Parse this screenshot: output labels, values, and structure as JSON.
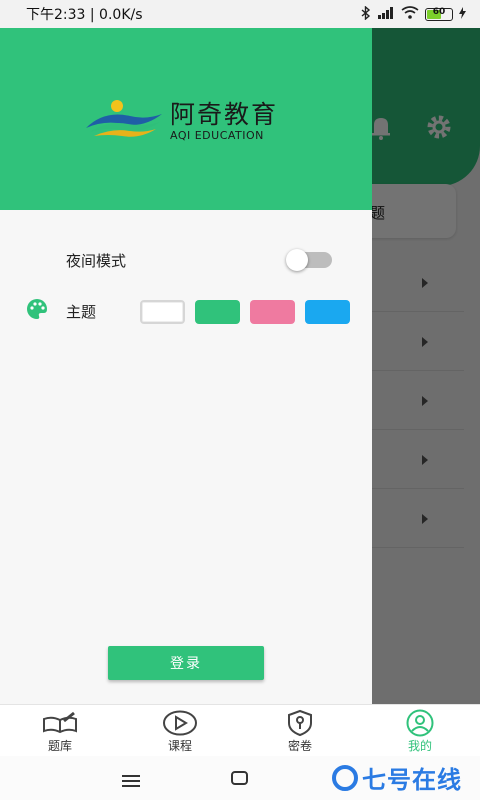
{
  "status_bar": {
    "time_speed": "下午2:33 | 0.0K/s",
    "battery": "60"
  },
  "background": {
    "card_text": "题"
  },
  "drawer": {
    "logo": {
      "name_cn": "阿奇教育",
      "name_en": "AQI EDUCATION"
    },
    "night_mode": {
      "label": "夜间模式",
      "enabled": false
    },
    "theme": {
      "label": "主题",
      "colors": [
        "#ffffff",
        "#30c27b",
        "#ef7aa0",
        "#1aa8f0"
      ]
    },
    "login_label": "登录"
  },
  "tabbar": {
    "tabs": [
      {
        "label": "题库",
        "icon": "book-icon",
        "active": false
      },
      {
        "label": "课程",
        "icon": "play-circle-icon",
        "active": false
      },
      {
        "label": "密卷",
        "icon": "shield-key-icon",
        "active": false
      },
      {
        "label": "我的",
        "icon": "user-icon",
        "active": true
      }
    ]
  },
  "watermark": "七号在线",
  "colors": {
    "accent": "#30c27b",
    "watermark": "#2b7be3"
  }
}
